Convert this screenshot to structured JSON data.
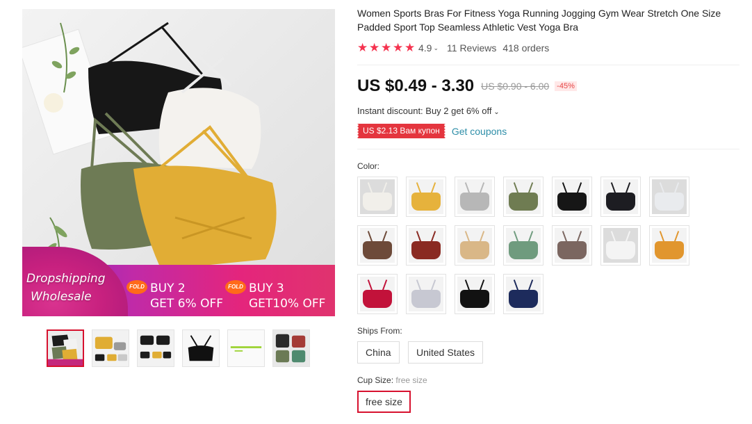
{
  "gallery": {
    "main_image_alt": "",
    "banner": {
      "dropshipping": "Dropshipping",
      "wholesale": "Wholesale",
      "fold_label": "FOLD",
      "promo1_line1": "BUY 2",
      "promo1_line2": "GET 6% OFF",
      "promo2_line1": "BUY 3",
      "promo2_line2": "GET10% OFF"
    },
    "thumbnails": [
      {
        "colors": [
          "#1c1c1c",
          "#f2f2f2",
          "#6b7a55",
          "#e0ad34"
        ],
        "active": true
      },
      {
        "colors": [
          "#e0ad34",
          "#1c1c1c",
          "#9a9a9a",
          "#e0ad34"
        ],
        "active": false
      },
      {
        "colors": [
          "#1c1c1c",
          "#1c1c1c",
          "#1c1c1c",
          "#e0ad34"
        ],
        "active": false
      },
      {
        "colors": [
          "#111111"
        ],
        "active": false
      },
      {
        "colors": [
          "#9fd43a"
        ],
        "active": false
      },
      {
        "colors": [
          "#2a2a2a",
          "#a43b36",
          "#6b7a55",
          "#4f8a6f"
        ],
        "active": false
      }
    ]
  },
  "product": {
    "title": "Women Sports Bras For Fitness Yoga Running Jogging Gym Wear Stretch One Size Padded Sport Top Seamless Athletic Vest Yoga Bra",
    "rating": "4.9",
    "reviews": "11 Reviews",
    "orders": "418 orders",
    "price": "US $0.49 - 3.30",
    "old_price": "US $0.90 - 6.00",
    "discount": "-45%",
    "instant_discount": "Instant discount: Buy 2 get 6% off",
    "coupon": "US $2.13 Вам купон",
    "get_coupons": "Get coupons"
  },
  "color": {
    "label": "Color:",
    "swatches": [
      {
        "name": "white",
        "hex": "#f1efea"
      },
      {
        "name": "yellow",
        "hex": "#e6b23c"
      },
      {
        "name": "gray",
        "hex": "#b7b7b7"
      },
      {
        "name": "army-green",
        "hex": "#6f7c52"
      },
      {
        "name": "black",
        "hex": "#161616"
      },
      {
        "name": "black-2",
        "hex": "#1d1d22"
      },
      {
        "name": "white-2",
        "hex": "#e9ebee"
      },
      {
        "name": "coffee",
        "hex": "#6d4a39"
      },
      {
        "name": "wine-red",
        "hex": "#8a2a22"
      },
      {
        "name": "khaki",
        "hex": "#d9b787"
      },
      {
        "name": "mint-green",
        "hex": "#6f9b7e"
      },
      {
        "name": "taupe",
        "hex": "#7b6660"
      },
      {
        "name": "white-3",
        "hex": "#f4f4f4"
      },
      {
        "name": "orange",
        "hex": "#e1962e"
      },
      {
        "name": "red",
        "hex": "#c2123a"
      },
      {
        "name": "light-gray",
        "hex": "#c7c8d2"
      },
      {
        "name": "black-3",
        "hex": "#121212"
      },
      {
        "name": "navy",
        "hex": "#1d2b5c"
      }
    ]
  },
  "ships_from": {
    "label": "Ships From:",
    "options": [
      "China",
      "United States"
    ]
  },
  "cup_size": {
    "label": "Cup Size:",
    "selected_value": "free size",
    "options": [
      "free size"
    ]
  },
  "colors": {
    "accent": "#d7112e",
    "star": "#f5334f",
    "coupon_bg": "#e4353e",
    "link": "#2e8ea8"
  }
}
